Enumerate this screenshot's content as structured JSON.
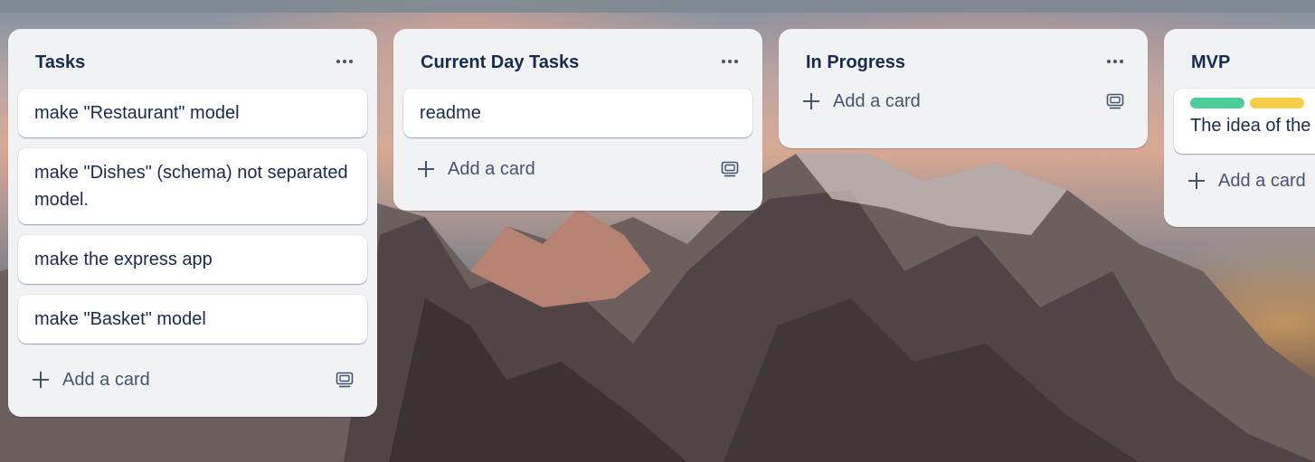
{
  "lists": [
    {
      "title": "Tasks",
      "cards": [
        {
          "text": "make \"Restaurant\" model"
        },
        {
          "text": "make \"Dishes\" (schema) not separated model."
        },
        {
          "text": "make the express app"
        },
        {
          "text": "make \"Basket\" model"
        }
      ],
      "add_label": "Add a card"
    },
    {
      "title": "Current Day Tasks",
      "cards": [
        {
          "text": "readme"
        }
      ],
      "add_label": "Add a card"
    },
    {
      "title": "In Progress",
      "cards": [],
      "add_label": "Add a card"
    },
    {
      "title": "MVP",
      "cards": [
        {
          "text": "The idea of the",
          "labels": [
            "#4bce97",
            "#f5cd47"
          ]
        }
      ],
      "add_label": "Add a card"
    }
  ],
  "icons": {
    "list_menu": "ellipsis-icon",
    "add": "plus-icon",
    "template": "card-template-icon"
  }
}
